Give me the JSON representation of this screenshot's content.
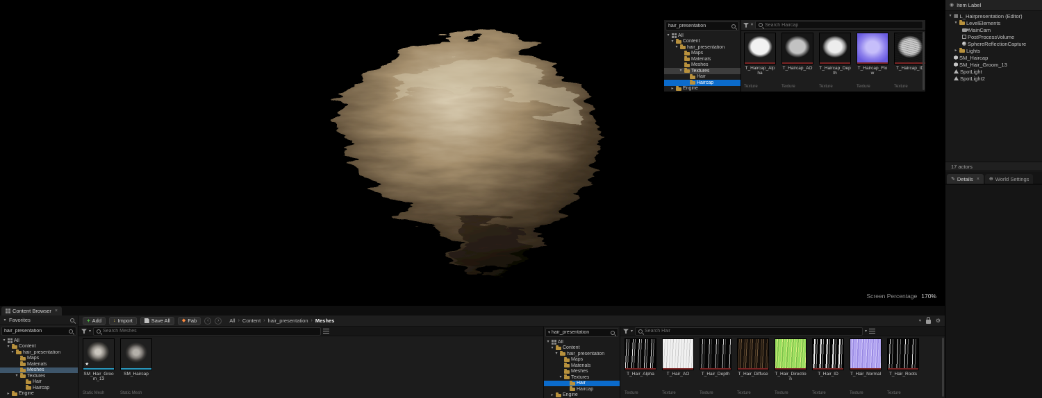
{
  "colors": {
    "selection": "#0b6bcb",
    "selection_dim": "#3e566b",
    "accent_green": "#4fbf44",
    "folder": "#b8913d"
  },
  "icons": {
    "expand_open": "▾",
    "expand_closed": "▸",
    "breadcrumb_sep": "›",
    "close": "×",
    "star": "★",
    "gear": "⚙",
    "plus": "+",
    "eye": "◉",
    "pencil": "✎",
    "globe": "⊕",
    "caret_down": "▾",
    "back": "‹",
    "forward": "›",
    "import_arrow": "↓",
    "fab_diamond": "◆",
    "level": "▦"
  },
  "viewport": {
    "screen_percentage_label": "Screen Percentage",
    "screen_percentage_value": "170%"
  },
  "tree": {
    "all": "All",
    "content": "Content",
    "project": "hair_presentation",
    "maps": "Maps",
    "materials": "Materials",
    "meshes": "Meshes",
    "textures": "Textures",
    "hair": "Hair",
    "haircap": "Haircap",
    "engine": "Engine"
  },
  "floating_browser": {
    "path_search_value": "hair_presentation",
    "search_placeholder": "Search Haircap",
    "assets": [
      {
        "name": "T_Haircap_Alpha",
        "type": "Texture"
      },
      {
        "name": "T_Haircap_AO",
        "type": "Texture"
      },
      {
        "name": "T_Haircap_Depth",
        "type": "Texture"
      },
      {
        "name": "T_Haircap_Flow",
        "type": "Texture"
      },
      {
        "name": "T_Haircap_ID",
        "type": "Texture"
      }
    ]
  },
  "outliner": {
    "header": "Item Label",
    "items": [
      {
        "label": "L_Hairpresentation (Editor)"
      },
      {
        "label": "LevelElements"
      },
      {
        "label": "MainCam"
      },
      {
        "label": "PostProcessVolume"
      },
      {
        "label": "SphereReflectionCapture"
      },
      {
        "label": "Lights"
      },
      {
        "label": "SM_Haircap"
      },
      {
        "label": "SM_Hair_Groom_13"
      },
      {
        "label": "SpotLight"
      },
      {
        "label": "SpotLight2"
      }
    ],
    "actor_count": "17 actors",
    "tabs": {
      "details": "Details",
      "world_settings": "World Settings"
    }
  },
  "content_browser": {
    "tab_label": "Content Browser",
    "favorites_label": "Favorites",
    "left_search_value": "hair_presentation",
    "toolbar": {
      "add": "Add",
      "import": "Import",
      "save_all": "Save All",
      "fab": "Fab"
    },
    "breadcrumb": [
      "All",
      "Content",
      "hair_presentation",
      "Meshes"
    ],
    "search_meshes_placeholder": "Search Meshes",
    "mesh_assets": [
      {
        "name": "SM_Hair_Groom_13",
        "type": "Static Mesh"
      },
      {
        "name": "SM_Haircap",
        "type": "Static Mesh"
      }
    ],
    "right_search_value": "hair_presentation",
    "search_hair_placeholder": "Search Hair",
    "texture_assets": [
      {
        "name": "T_Hair_Alpha",
        "type": "Texture"
      },
      {
        "name": "T_Hair_AO",
        "type": "Texture"
      },
      {
        "name": "T_Hair_Depth",
        "type": "Texture"
      },
      {
        "name": "T_Hair_Diffuse",
        "type": "Texture"
      },
      {
        "name": "T_Hair_Direction",
        "type": "Texture"
      },
      {
        "name": "T_Hair_ID",
        "type": "Texture"
      },
      {
        "name": "T_Hair_Normal",
        "type": "Texture"
      },
      {
        "name": "T_Hair_Roots",
        "type": "Texture"
      }
    ]
  }
}
